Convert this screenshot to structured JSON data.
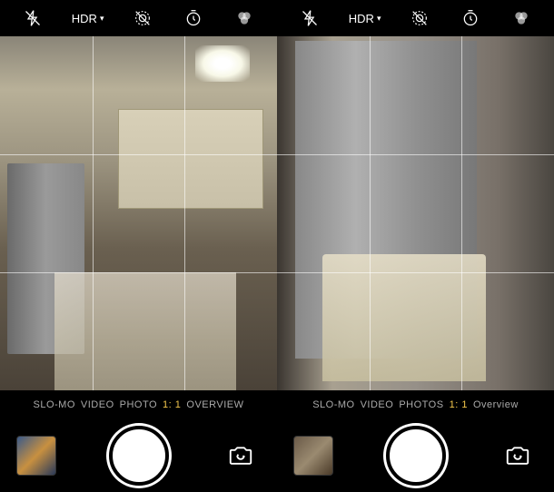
{
  "left": {
    "topbar": {
      "flash": "flash-off-icon",
      "hdr": "HDR",
      "liveoff": "live-photo-off-icon",
      "timer": "timer-icon",
      "filters": "filters-icon"
    },
    "modes": {
      "m1": "SLO-MO",
      "m2": "VIDEO",
      "m3": "PHOTO",
      "m4": "1: 1",
      "m5": "OVERVIEW"
    }
  },
  "right": {
    "topbar": {
      "flash": "flash-off-icon",
      "hdr": "HDR",
      "liveoff": "live-photo-off-icon",
      "timer": "timer-icon",
      "filters": "filters-icon"
    },
    "modes": {
      "m1": "SLO-MO",
      "m2": "VIDEO",
      "m3": "PHOTOS",
      "m4": "1: 1",
      "m5": "Overview"
    }
  }
}
